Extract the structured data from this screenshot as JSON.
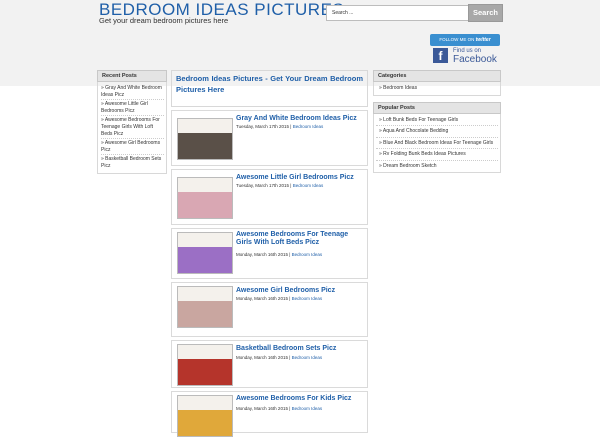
{
  "header": {
    "title": "BEDROOM IDEAS PICTURES",
    "description": "Get your dream bedroom pictures here",
    "search_placeholder": "Search ...",
    "search_button": "Search",
    "twitter_label": "FOLLOW ME ON",
    "twitter_brand": "twitter",
    "facebook_line1": "Find us on",
    "facebook_line2": "Facebook",
    "facebook_icon_letter": "f"
  },
  "left_sidebar": {
    "title": "Recent Posts",
    "items": [
      "» Gray And White Bedroom Ideas Picz",
      "» Awesome Little Girl Bedrooms Picz",
      "» Awesome Bedrooms For Teenage Girls With Loft Beds Picz",
      "» Awesome Girl Bedrooms Picz",
      "» Basketball Bedroom Sets Picz"
    ]
  },
  "main": {
    "title": "Bedroom Ideas Pictures - Get Your Dream Bedroom Pictures Here",
    "posts": [
      {
        "title": "Gray And White Bedroom Ideas Picz",
        "date": "Tuesday, March 17th 2015",
        "sep": " | ",
        "category": "Bedroom Ideas",
        "thumb_color": "#5a5048"
      },
      {
        "title": "Awesome Little Girl Bedrooms Picz",
        "date": "Tuesday, March 17th 2015",
        "sep": " | ",
        "category": "Bedroom Ideas",
        "thumb_color": "#d9a7b3"
      },
      {
        "title": "Awesome Bedrooms For Teenage Girls With Loft Beds Picz",
        "date": "Monday, March 16th 2015",
        "sep": " | ",
        "category": "Bedroom Ideas",
        "thumb_color": "#9b6fc5"
      },
      {
        "title": "Awesome Girl Bedrooms Picz",
        "date": "Monday, March 16th 2015",
        "sep": " | ",
        "category": "Bedroom Ideas",
        "thumb_color": "#c9a6a0"
      },
      {
        "title": "Basketball Bedroom Sets Picz",
        "date": "Monday, March 16th 2015",
        "sep": " | ",
        "category": "Bedroom Ideas",
        "thumb_color": "#b5342b"
      },
      {
        "title": "Awesome Bedrooms For Kids Picz",
        "date": "Monday, March 16th 2015",
        "sep": " | ",
        "category": "Bedroom Ideas",
        "thumb_color": "#e0a83a"
      }
    ]
  },
  "right_sidebar": {
    "categories_title": "Categories",
    "categories": [
      "» Bedroom Ideas"
    ],
    "popular_title": "Popular Posts",
    "popular": [
      "» Loft Bunk Beds For Teenage Girls",
      "» Aqua And Chocolate Bedding",
      "» Blue And Black Bedroom Ideas For Teenage Girls",
      "» Rv Folding Bunk Beds Ideas Pictures",
      "» Dream Bedroom Sketch"
    ]
  },
  "colors": {
    "accent": "#1f5fa8",
    "twitter": "#3a8fd0",
    "facebook": "#3b5998"
  }
}
